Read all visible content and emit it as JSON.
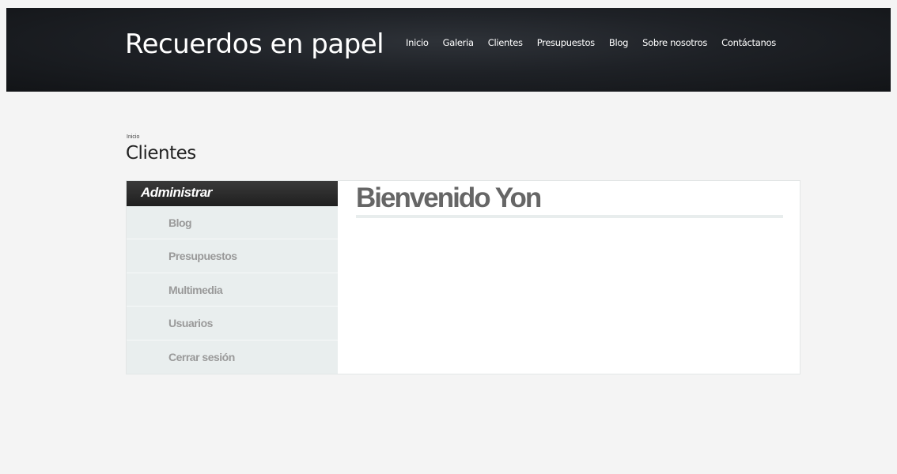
{
  "header": {
    "site_title": "Recuerdos en papel",
    "nav": [
      {
        "label": "Inicio"
      },
      {
        "label": "Galeria"
      },
      {
        "label": "Clientes"
      },
      {
        "label": "Presupuestos"
      },
      {
        "label": "Blog"
      },
      {
        "label": "Sobre nosotros"
      },
      {
        "label": "Contáctanos"
      }
    ]
  },
  "breadcrumb": "Inicio",
  "page_title": "Clientes",
  "sidebar": {
    "heading": "Administrar",
    "items": [
      {
        "label": "Blog"
      },
      {
        "label": "Presupuestos"
      },
      {
        "label": "Multimedia"
      },
      {
        "label": "Usuarios"
      },
      {
        "label": "Cerrar sesión"
      }
    ]
  },
  "main": {
    "welcome": "Bienvenido Yon"
  }
}
